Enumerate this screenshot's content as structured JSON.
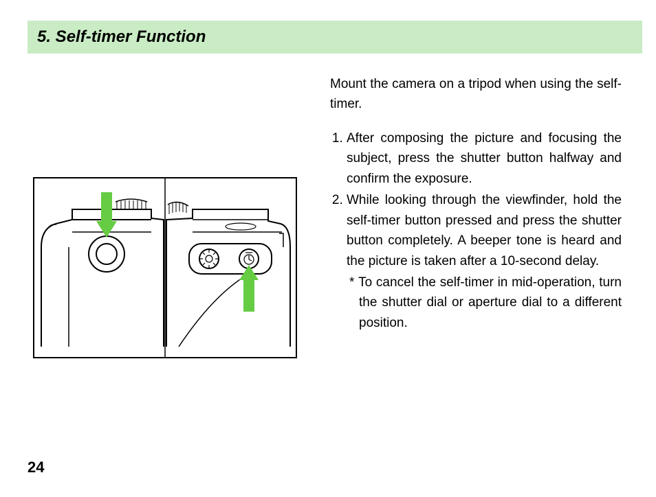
{
  "heading": "5. Self-timer Function",
  "intro": "Mount the camera on a tripod when using the self-timer.",
  "steps": [
    "After composing the picture and focusing the subject, press the shutter button halfway and confirm the exposure.",
    "While looking through the viewfinder, hold the self-timer button pressed and press the shutter button completely. A beeper tone is heard and the picture is taken after a 10-second delay."
  ],
  "note_marker": "*",
  "note": "To cancel the self-timer in mid-operation, turn the shutter dial or aperture dial to a different position.",
  "page_number": "24",
  "figure_alt": "Top view of camera showing shutter button and self-timer button with green arrows"
}
